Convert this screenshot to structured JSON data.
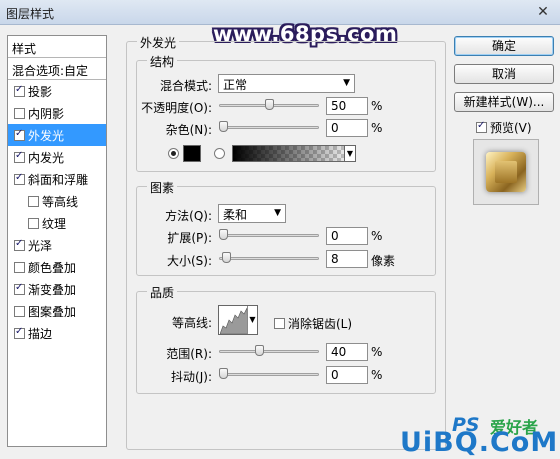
{
  "window": {
    "title": "图层样式",
    "close_glyph": "✕"
  },
  "watermark_top": "www.68ps.com",
  "sidebar": {
    "header": "样式",
    "blend": "混合选项:自定",
    "items": [
      {
        "label": "投影",
        "checked": true
      },
      {
        "label": "内阴影",
        "checked": false
      },
      {
        "label": "外发光",
        "checked": true,
        "active": true
      },
      {
        "label": "内发光",
        "checked": true
      },
      {
        "label": "斜面和浮雕",
        "checked": true
      },
      {
        "label": "等高线",
        "checked": false,
        "sub": true
      },
      {
        "label": "纹理",
        "checked": false,
        "sub": true
      },
      {
        "label": "光泽",
        "checked": true
      },
      {
        "label": "颜色叠加",
        "checked": false
      },
      {
        "label": "渐变叠加",
        "checked": true
      },
      {
        "label": "图案叠加",
        "checked": false
      },
      {
        "label": "描边",
        "checked": true
      }
    ]
  },
  "outer_glow": {
    "title": "外发光",
    "structure": {
      "title": "结构",
      "blend_mode_label": "混合模式:",
      "blend_mode_value": "正常",
      "opacity_label": "不透明度(O):",
      "opacity_value": "50",
      "opacity_unit": "%",
      "noise_label": "杂色(N):",
      "noise_value": "0",
      "noise_unit": "%",
      "color": "#000000"
    },
    "elements": {
      "title": "图素",
      "technique_label": "方法(Q):",
      "technique_value": "柔和",
      "spread_label": "扩展(P):",
      "spread_value": "0",
      "spread_unit": "%",
      "size_label": "大小(S):",
      "size_value": "8",
      "size_unit": "像素"
    },
    "quality": {
      "title": "品质",
      "contour_label": "等高线:",
      "antialias_label": "消除锯齿(L)",
      "antialias_checked": false,
      "range_label": "范围(R):",
      "range_value": "40",
      "range_unit": "%",
      "jitter_label": "抖动(J):",
      "jitter_value": "0",
      "jitter_unit": "%"
    }
  },
  "buttons": {
    "ok": "确定",
    "cancel": "取消",
    "new_style": "新建样式(W)...",
    "preview_label": "预览(V)",
    "preview_checked": true
  },
  "watermark_bottom": {
    "ps_mark": "PS",
    "site_cn": "爱好者",
    "site": "UiBQ.CoM"
  },
  "colors": {
    "accent": "#3399ff",
    "watermark_outline": "#2b1d5c",
    "watermark_bottom": "#1e78c8"
  }
}
